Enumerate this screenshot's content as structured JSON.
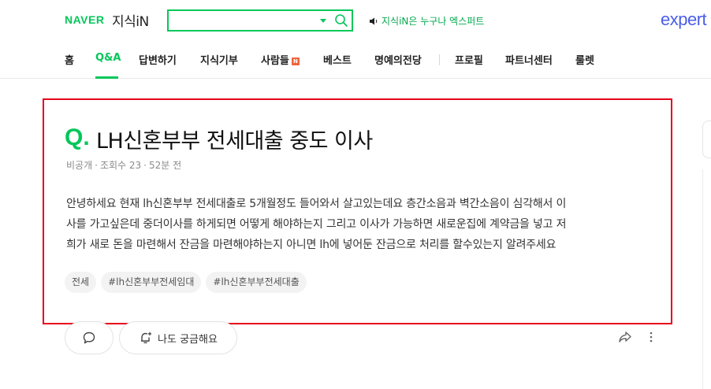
{
  "header": {
    "naver_logo": "NAVER",
    "service_logo": "지식iN",
    "search_value": "",
    "notice_text": "지식iN은 누구나 엑스퍼트",
    "expert_logo": "expert"
  },
  "nav": {
    "items": [
      "홈",
      "Q&A",
      "답변하기",
      "지식기부",
      "사람들",
      "베스트",
      "명예의전당",
      "프로필",
      "파트너센터",
      "룰렛"
    ],
    "active": "Q&A",
    "new_badge": "N"
  },
  "question": {
    "q_mark": "Q.",
    "title": "LH신혼부부 전세대출 중도 이사",
    "author": "비공개",
    "views_label": "조회수 23",
    "time": "52분 전",
    "body_lines": [
      "안녕하세요 현재 lh신혼부부 전세대출로 5개월정도 들어와서 살고있는데요 층간소음과 벽간소음이 심각해서 이",
      "사를 가고싶은데 중더이사를 하게되면 어떻게 해야하는지 그리고 이사가 가능하면 새로운집에 계약금을 넣고 저",
      "희가 새로 돈을 마련해서 잔금을 마련해야하는지 아니면 lh에 넣어둔 잔금으로 처리를 할수있는지 알려주세요"
    ],
    "tags": [
      "전세",
      "#lh신혼부부전세임대",
      "#lh신혼부부전세대출"
    ]
  },
  "actions": {
    "curious_label": "나도 궁금해요"
  },
  "colors": {
    "brand_green": "#03c75a",
    "highlight_red": "#e5001a",
    "expert_blue": "#4a5ee8"
  },
  "icons": [
    "search-icon",
    "speaker-icon",
    "comment-icon",
    "bell-plus-icon",
    "share-icon",
    "more-vertical-icon"
  ]
}
